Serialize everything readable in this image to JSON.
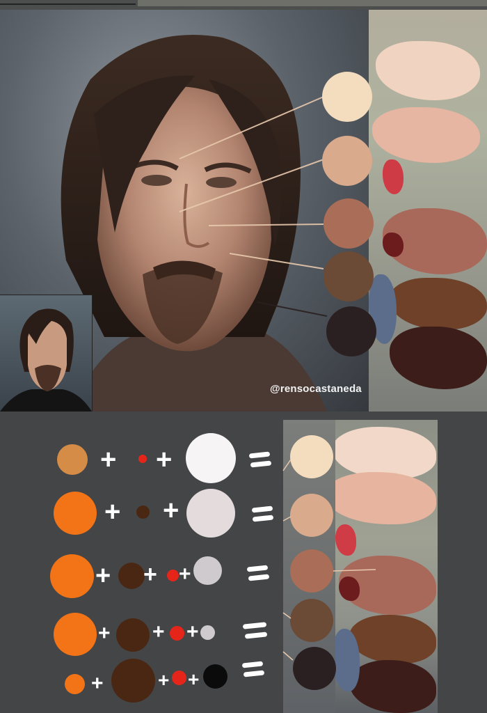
{
  "watermark": "@rensocastaneda",
  "palette_colors": [
    "#f4dcbe",
    "#d9aa8c",
    "#a96d58",
    "#6b4a36",
    "#2b2021"
  ],
  "mix_colors": {
    "orange": "#f27417",
    "ochre": "#d58c46",
    "dark_brown": "#4a2712",
    "red": "#e5251a",
    "white": "#f6f4f5",
    "light_gray": "#e4dcdc",
    "gray": "#cfcace",
    "black": "#0b0b0b"
  },
  "icons": [
    "plus-icon",
    "equals-icon"
  ]
}
